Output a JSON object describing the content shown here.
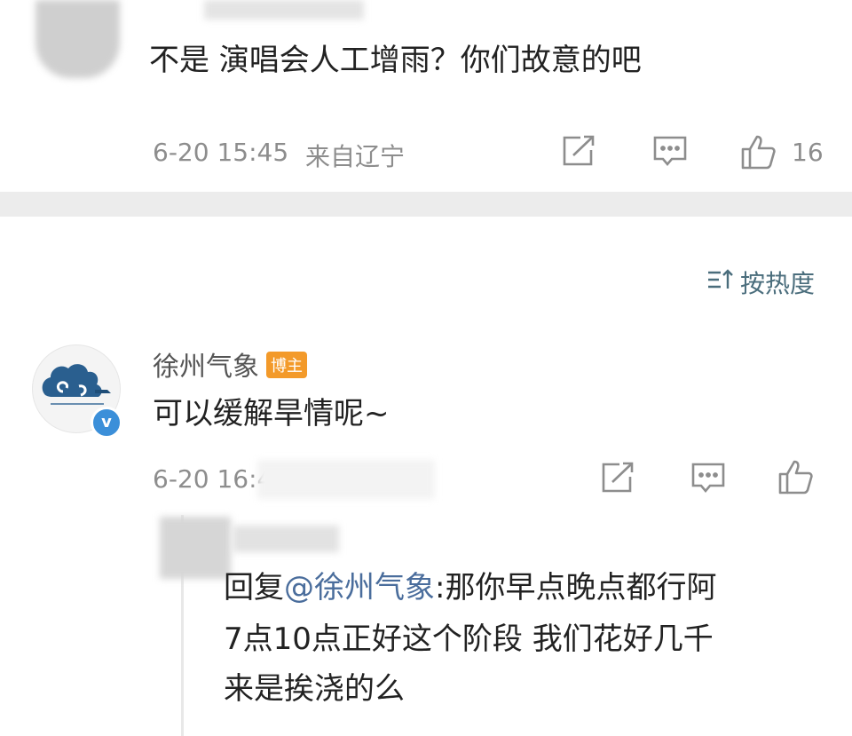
{
  "comment1": {
    "text": "不是 演唱会人工增雨？你们故意的吧",
    "time": "6-20 15:45",
    "location": "来自辽宁",
    "like_count": "16"
  },
  "sort_label": "按热度",
  "comment2": {
    "username": "徐州气象",
    "badge": "博主",
    "text": "可以缓解旱情呢~",
    "time": "6-20 16:4"
  },
  "reply": {
    "prefix": "回复",
    "mention": "@徐州气象",
    "line1_rest": ":那你早点晚点都行阿",
    "line2": "7点10点正好这个阶段 我们花好几千",
    "line3": "来是挨浇的么"
  },
  "colors": {
    "accent_link": "#4a6d9c",
    "badge": "#f39a2a",
    "verified": "#3b8fd9",
    "divider": "#ececec"
  },
  "icons": [
    "share-icon",
    "comment-icon",
    "like-icon",
    "sort-icon",
    "verified-icon"
  ]
}
